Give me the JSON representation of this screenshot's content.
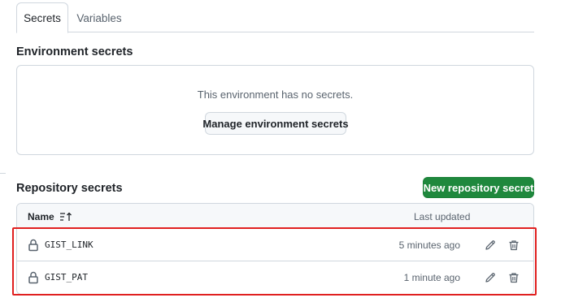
{
  "tabs": [
    {
      "label": "Secrets",
      "active": true
    },
    {
      "label": "Variables",
      "active": false
    }
  ],
  "environment": {
    "title": "Environment secrets",
    "empty_message": "This environment has no secrets.",
    "manage_button": "Manage environment secrets"
  },
  "repository": {
    "title": "Repository secrets",
    "new_button": "New repository secret",
    "columns": {
      "name": "Name",
      "updated": "Last updated"
    },
    "secrets": [
      {
        "name": "GIST_LINK",
        "updated": "5 minutes ago"
      },
      {
        "name": "GIST_PAT",
        "updated": "1 minute ago"
      }
    ]
  },
  "icons": {
    "sort": "sort-ascending-icon",
    "lock": "lock-icon",
    "edit": "pencil-icon",
    "delete": "trash-icon"
  },
  "colors": {
    "primary_button": "#1f883d",
    "highlight": "#e02020",
    "border": "#d0d7de"
  }
}
